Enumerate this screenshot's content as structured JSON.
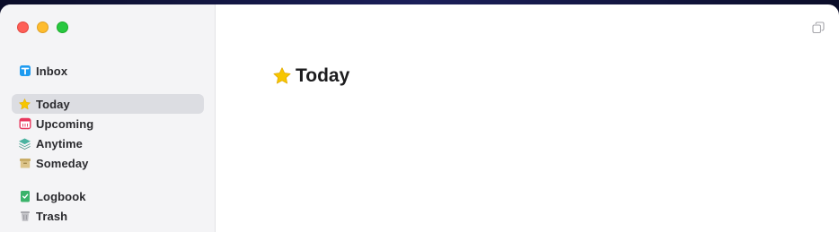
{
  "window": {
    "controls": [
      "close",
      "minimize",
      "zoom"
    ]
  },
  "sidebar": {
    "items": [
      {
        "id": "inbox",
        "label": "Inbox",
        "icon": "inbox-icon",
        "color": "#1e9bf0",
        "selected": false
      },
      {
        "id": "today",
        "label": "Today",
        "icon": "star-icon",
        "color": "#f5c400",
        "selected": true
      },
      {
        "id": "upcoming",
        "label": "Upcoming",
        "icon": "calendar-icon",
        "color": "#e8375d",
        "selected": false
      },
      {
        "id": "anytime",
        "label": "Anytime",
        "icon": "layers-icon",
        "color": "#3a9b8a",
        "selected": false
      },
      {
        "id": "someday",
        "label": "Someday",
        "icon": "archive-box-icon",
        "color": "#c9ad67",
        "selected": false
      },
      {
        "id": "logbook",
        "label": "Logbook",
        "icon": "logbook-icon",
        "color": "#3bb36a",
        "selected": false
      },
      {
        "id": "trash",
        "label": "Trash",
        "icon": "trash-icon",
        "color": "#9a9aa0",
        "selected": false
      }
    ]
  },
  "main": {
    "title": "Today",
    "title_icon": "star-icon"
  }
}
